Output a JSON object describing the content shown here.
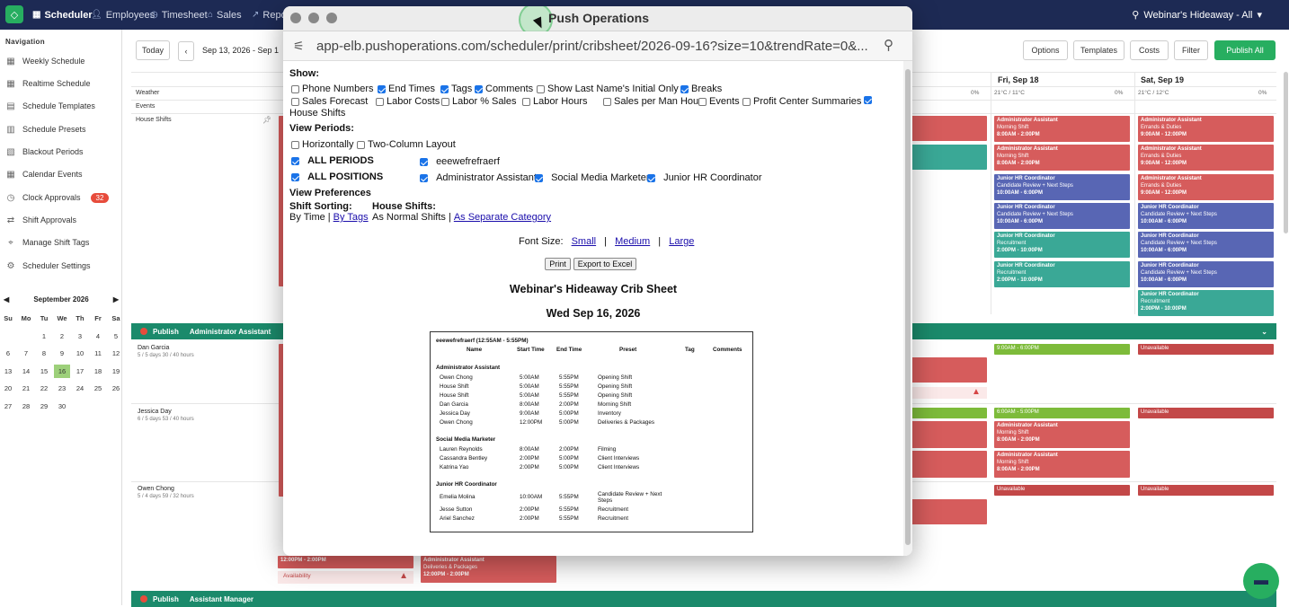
{
  "topnav": {
    "items": [
      {
        "label": "Scheduler",
        "icon": "calendar-icon"
      },
      {
        "label": "Employees",
        "icon": "person-icon"
      },
      {
        "label": "Timesheet",
        "icon": "clock-icon"
      },
      {
        "label": "Sales",
        "icon": "bank-icon"
      },
      {
        "label": "Repo",
        "icon": "chart-icon"
      }
    ],
    "location": "Webinar's Hideaway - All"
  },
  "sidebar": {
    "heading": "Navigation",
    "items": [
      {
        "label": "Weekly Schedule",
        "icon": "calendar-icon"
      },
      {
        "label": "Realtime Schedule",
        "icon": "calendar-icon"
      },
      {
        "label": "Schedule Templates",
        "icon": "template-icon"
      },
      {
        "label": "Schedule Presets",
        "icon": "preset-icon"
      },
      {
        "label": "Blackout Periods",
        "icon": "blackout-icon"
      },
      {
        "label": "Calendar Events",
        "icon": "calendar-icon"
      },
      {
        "label": "Clock Approvals",
        "icon": "clock-icon",
        "badge": "32"
      },
      {
        "label": "Shift Approvals",
        "icon": "shift-icon"
      },
      {
        "label": "Manage Shift Tags",
        "icon": "tag-icon"
      },
      {
        "label": "Scheduler Settings",
        "icon": "gear-icon"
      }
    ],
    "calendar": {
      "month": "September 2026",
      "days": [
        "Su",
        "Mo",
        "Tu",
        "We",
        "Th",
        "Fr",
        "Sa"
      ],
      "weeks": [
        [
          "",
          "",
          "1",
          "2",
          "3",
          "4",
          "5"
        ],
        [
          "6",
          "7",
          "8",
          "9",
          "10",
          "11",
          "12"
        ],
        [
          "13",
          "14",
          "15",
          "16",
          "17",
          "18",
          "19"
        ],
        [
          "20",
          "21",
          "22",
          "23",
          "24",
          "25",
          "26"
        ],
        [
          "27",
          "28",
          "29",
          "30",
          "",
          "",
          ""
        ]
      ],
      "selected": "16"
    }
  },
  "toolbar": {
    "today": "Today",
    "date_range": "Sep 13, 2026 - Sep 1",
    "options": "Options",
    "templates": "Templates",
    "costs": "Costs",
    "filter": "Filter",
    "publish_all": "Publish All"
  },
  "schedule": {
    "days": [
      {
        "label": "Fri, Sep 18",
        "weather": "21°C / 11°C",
        "precip": "0%"
      },
      {
        "label": "Sat, Sep 19",
        "weather": "21°C / 12°C",
        "precip": "0%"
      }
    ],
    "precip_partial": "0%",
    "rows": {
      "weather": "Weather",
      "events": "Events",
      "house": "House Shifts"
    },
    "sections": [
      {
        "publish": "Publish",
        "name": "Administrator Assistant"
      },
      {
        "publish": "Publish",
        "name": "Assistant Manager"
      }
    ],
    "employees": [
      {
        "name": "Dan Garcia",
        "meta": "5 / 5 days    30 / 40 hours"
      },
      {
        "name": "Jessica Day",
        "meta": "6 / 5 days    53 / 40 hours"
      },
      {
        "name": "Owen Chong",
        "meta": "5 / 4 days    59 / 32 hours"
      }
    ],
    "fri_house": [
      {
        "title": "Administrator Assistant",
        "sub": "Morning Shift",
        "time": "8:00AM - 2:00PM",
        "color": "red"
      },
      {
        "title": "Administrator Assistant",
        "sub": "Morning Shift",
        "time": "8:00AM - 2:00PM",
        "color": "red"
      },
      {
        "title": "Junior HR Coordinator",
        "sub": "Candidate Review + Next Steps",
        "time": "10:00AM - 6:00PM",
        "color": "blue"
      },
      {
        "title": "Junior HR Coordinator",
        "sub": "Candidate Review + Next Steps",
        "time": "10:00AM - 6:00PM",
        "color": "blue"
      },
      {
        "title": "Junior HR Coordinator",
        "sub": "Recruitment",
        "time": "2:00PM - 10:00PM",
        "color": "teal"
      },
      {
        "title": "Junior HR Coordinator",
        "sub": "Recruitment",
        "time": "2:00PM - 10:00PM",
        "color": "teal"
      }
    ],
    "sat_house": [
      {
        "title": "Administrator Assistant",
        "sub": "Errands & Duties",
        "time": "9:00AM - 12:00PM",
        "color": "red"
      },
      {
        "title": "Administrator Assistant",
        "sub": "Errands & Duties",
        "time": "9:00AM - 12:00PM",
        "color": "red"
      },
      {
        "title": "Administrator Assistant",
        "sub": "Errands & Duties",
        "time": "9:00AM - 12:00PM",
        "color": "red"
      },
      {
        "title": "Junior HR Coordinator",
        "sub": "Candidate Review + Next Steps",
        "time": "10:00AM - 6:00PM",
        "color": "blue"
      },
      {
        "title": "Junior HR Coordinator",
        "sub": "Candidate Review + Next Steps",
        "time": "10:00AM - 6:00PM",
        "color": "blue"
      },
      {
        "title": "Junior HR Coordinator",
        "sub": "Candidate Review + Next Steps",
        "time": "10:00AM - 6:00PM",
        "color": "blue"
      },
      {
        "title": "Junior HR Coordinator",
        "sub": "Recruitment",
        "time": "2:00PM - 10:00PM",
        "color": "teal"
      }
    ],
    "emp_cells": {
      "dan_fri": "9:00AM - 6:00PM",
      "dan_sat": "Unavailable",
      "jess_fri_avail": "6:00AM - 5:00PM",
      "jess_fri_1": {
        "title": "Administrator Assistant",
        "sub": "Morning Shift",
        "time": "8:00AM - 2:00PM"
      },
      "jess_fri_2": {
        "title": "Administrator Assistant",
        "sub": "Morning Shift",
        "time": "8:00AM - 2:00PM"
      },
      "jess_sat": "Unavailable",
      "owen_fri": "Unavailable",
      "owen_sat": "Unavailable"
    },
    "bottom_cells": {
      "c1_time": "12:00PM - 2:00PM",
      "c1_avail": "Availability",
      "c2_title": "Administrator Assistant",
      "c2_sub": "Deliveries & Packages",
      "c2_time": "12:00PM - 2:00PM"
    }
  },
  "popup": {
    "title": "Push Operations",
    "url": "app-elb.pushoperations.com/scheduler/print/cribsheet/2026-09-16?size=10&trendRate=0&...",
    "show_label": "Show:",
    "show_row1": [
      {
        "label": "Phone Numbers",
        "checked": false
      },
      {
        "label": "End Times",
        "checked": true
      },
      {
        "label": "Tags",
        "checked": true
      },
      {
        "label": "Comments",
        "checked": true
      },
      {
        "label": "Show Last Name's Initial Only",
        "checked": false
      },
      {
        "label": "Breaks",
        "checked": true
      }
    ],
    "show_row2": [
      {
        "label": "Sales Forecast",
        "checked": false
      },
      {
        "label": "Labor Costs",
        "checked": false
      },
      {
        "label": "Labor % Sales",
        "checked": false
      },
      {
        "label": "Labor Hours",
        "checked": false
      },
      {
        "label": "Sales per Man Hours",
        "checked": false
      },
      {
        "label": "Events",
        "checked": false
      },
      {
        "label": "Profit Center Summaries",
        "checked": false
      },
      {
        "label": "",
        "checked": true
      }
    ],
    "house_shifts": "House Shifts",
    "view_periods": "View Periods:",
    "horizontally": "Horizontally",
    "two_column": "Two-Column Layout",
    "all_periods": "ALL PERIODS",
    "period_name": "eeewefrefraerf",
    "all_positions": "ALL POSITIONS",
    "positions": [
      "Administrator Assistant",
      "Social Media Marketer",
      "Junior HR Coordinator"
    ],
    "view_prefs": "View Preferences",
    "shift_sorting": "Shift Sorting:",
    "by_time": "By Time |",
    "by_tags": "By Tags",
    "house_shifts_label": "House Shifts:",
    "as_normal": "As Normal Shifts |",
    "as_separate": "As Separate Category",
    "font_size": "Font Size:",
    "small": "Small",
    "medium": "Medium",
    "large": "Large",
    "sep": "|",
    "print": "Print",
    "export": "Export to Excel",
    "sheet_title": "Webinar's Hideaway Crib Sheet",
    "sheet_date": "Wed Sep 16, 2026",
    "crib": {
      "period": "eeewefrefraerf (12:55AM - 5:55PM)",
      "headers": [
        "Name",
        "Start Time",
        "End Time",
        "Preset",
        "Tag",
        "Comments"
      ],
      "groups": [
        {
          "name": "Administrator Assistant",
          "rows": [
            [
              "Owen Chong",
              "5:00AM",
              "5:55PM",
              "Opening Shift"
            ],
            [
              "House Shift",
              "5:00AM",
              "5:55PM",
              "Opening Shift"
            ],
            [
              "House Shift",
              "5:00AM",
              "5:55PM",
              "Opening Shift"
            ],
            [
              "Dan Garcia",
              "8:00AM",
              "2:00PM",
              "Morning Shift"
            ],
            [
              "Jessica Day",
              "9:00AM",
              "5:00PM",
              "Inventory"
            ],
            [
              "Owen Chong",
              "12:00PM",
              "5:00PM",
              "Deliveries & Packages"
            ]
          ]
        },
        {
          "name": "Social Media Marketer",
          "rows": [
            [
              "Lauren Reynolds",
              "8:00AM",
              "2:00PM",
              "Filming"
            ],
            [
              "Cassandra Bentley",
              "2:00PM",
              "5:00PM",
              "Client Interviews"
            ],
            [
              "Katrina Yao",
              "2:00PM",
              "5:00PM",
              "Client Interviews"
            ]
          ]
        },
        {
          "name": "Junior HR Coordinator",
          "rows": [
            [
              "Emelia Molina",
              "10:00AM",
              "5:55PM",
              "Candidate Review + Next Steps"
            ],
            [
              "Jesse Sutton",
              "2:00PM",
              "5:55PM",
              "Recruitment"
            ],
            [
              "Ariel Sanchez",
              "2:00PM",
              "5:55PM",
              "Recruitment"
            ]
          ]
        }
      ]
    }
  }
}
